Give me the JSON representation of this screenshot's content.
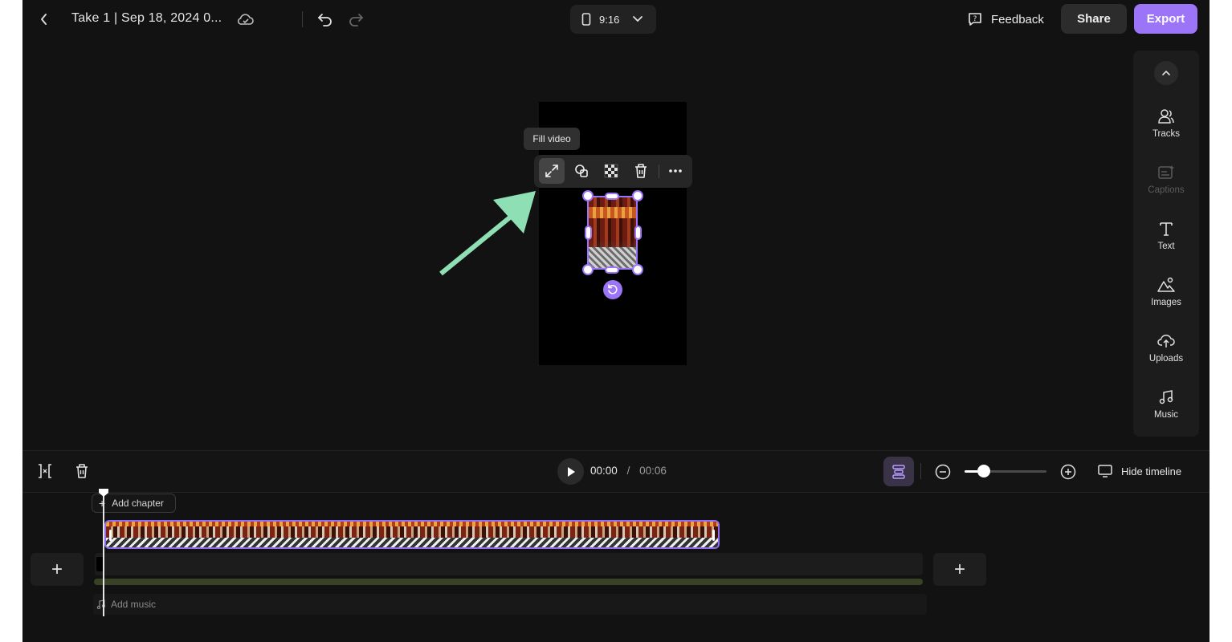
{
  "header": {
    "title": "Take 1 | Sep 18, 2024 0...",
    "aspect_ratio": "9:16",
    "feedback_label": "Feedback",
    "share_label": "Share",
    "export_label": "Export"
  },
  "sidebar": {
    "items": [
      {
        "label": "Tracks",
        "icon": "tracks-icon",
        "enabled": true
      },
      {
        "label": "Captions",
        "icon": "captions-icon",
        "enabled": false
      },
      {
        "label": "Text",
        "icon": "text-icon",
        "enabled": true
      },
      {
        "label": "Images",
        "icon": "images-icon",
        "enabled": true
      },
      {
        "label": "Uploads",
        "icon": "uploads-icon",
        "enabled": true
      },
      {
        "label": "Music",
        "icon": "music-icon",
        "enabled": true
      }
    ]
  },
  "canvas": {
    "tooltip": "Fill video",
    "toolbar_icons": [
      "fill-video-icon",
      "replace-icon",
      "transparency-icon",
      "trash-icon",
      "more-icon"
    ]
  },
  "timeline": {
    "current_time": "00:00",
    "separator": "/",
    "duration": "00:06",
    "zoom_level": 0.24,
    "hide_timeline_label": "Hide timeline",
    "add_chapter_label": "Add chapter",
    "add_music_label": "Add music"
  },
  "colors": {
    "accent": "#9b74f7",
    "background": "#121212",
    "arrow": "#8ee0b4"
  }
}
